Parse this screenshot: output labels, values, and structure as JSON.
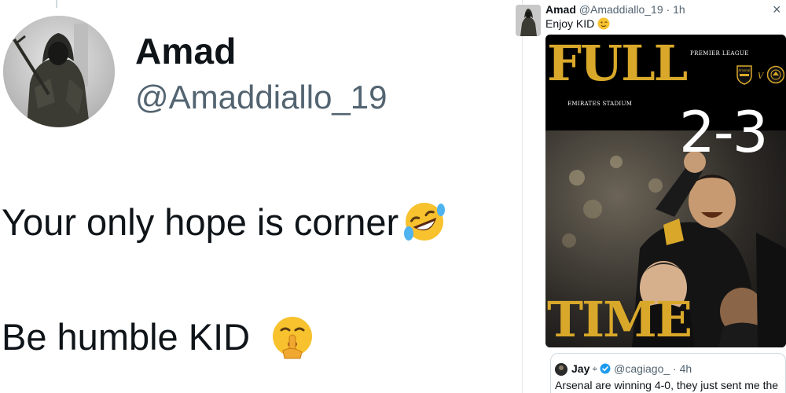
{
  "main_tweet": {
    "display_name": "Amad",
    "handle": "@Amaddiallo_19",
    "line1": "Your only hope is corner",
    "line1_emoji": "rolling-on-floor-laughing-emoji",
    "line2": "Be humble KID",
    "line2_emoji": "shushing-face-emoji"
  },
  "side_tweet": {
    "display_name": "Amad",
    "handle_time": "@Amaddiallo_19 · 1h",
    "text": "Enjoy KID",
    "emoji": "winking-face-emoji",
    "close_icon": "×",
    "media": {
      "top_word": "FULL",
      "bottom_word": "TIME",
      "league": "PREMIER LEAGUE",
      "venue": "EMIRATES STADIUM",
      "vs": "V",
      "score": "2-3",
      "home_badge": "arsenal-crest",
      "away_badge": "man-utd-crest"
    },
    "quote": {
      "display_name": "Jay",
      "symbol": "⌖",
      "handle_time": "@cagiago_ · 4h",
      "text": "Arsenal are winning 4-0, they just sent me the"
    }
  },
  "colors": {
    "text_primary": "#0f1419",
    "text_secondary": "#536471",
    "gold": "#d9a82a",
    "verified_blue": "#1d9bf0"
  }
}
